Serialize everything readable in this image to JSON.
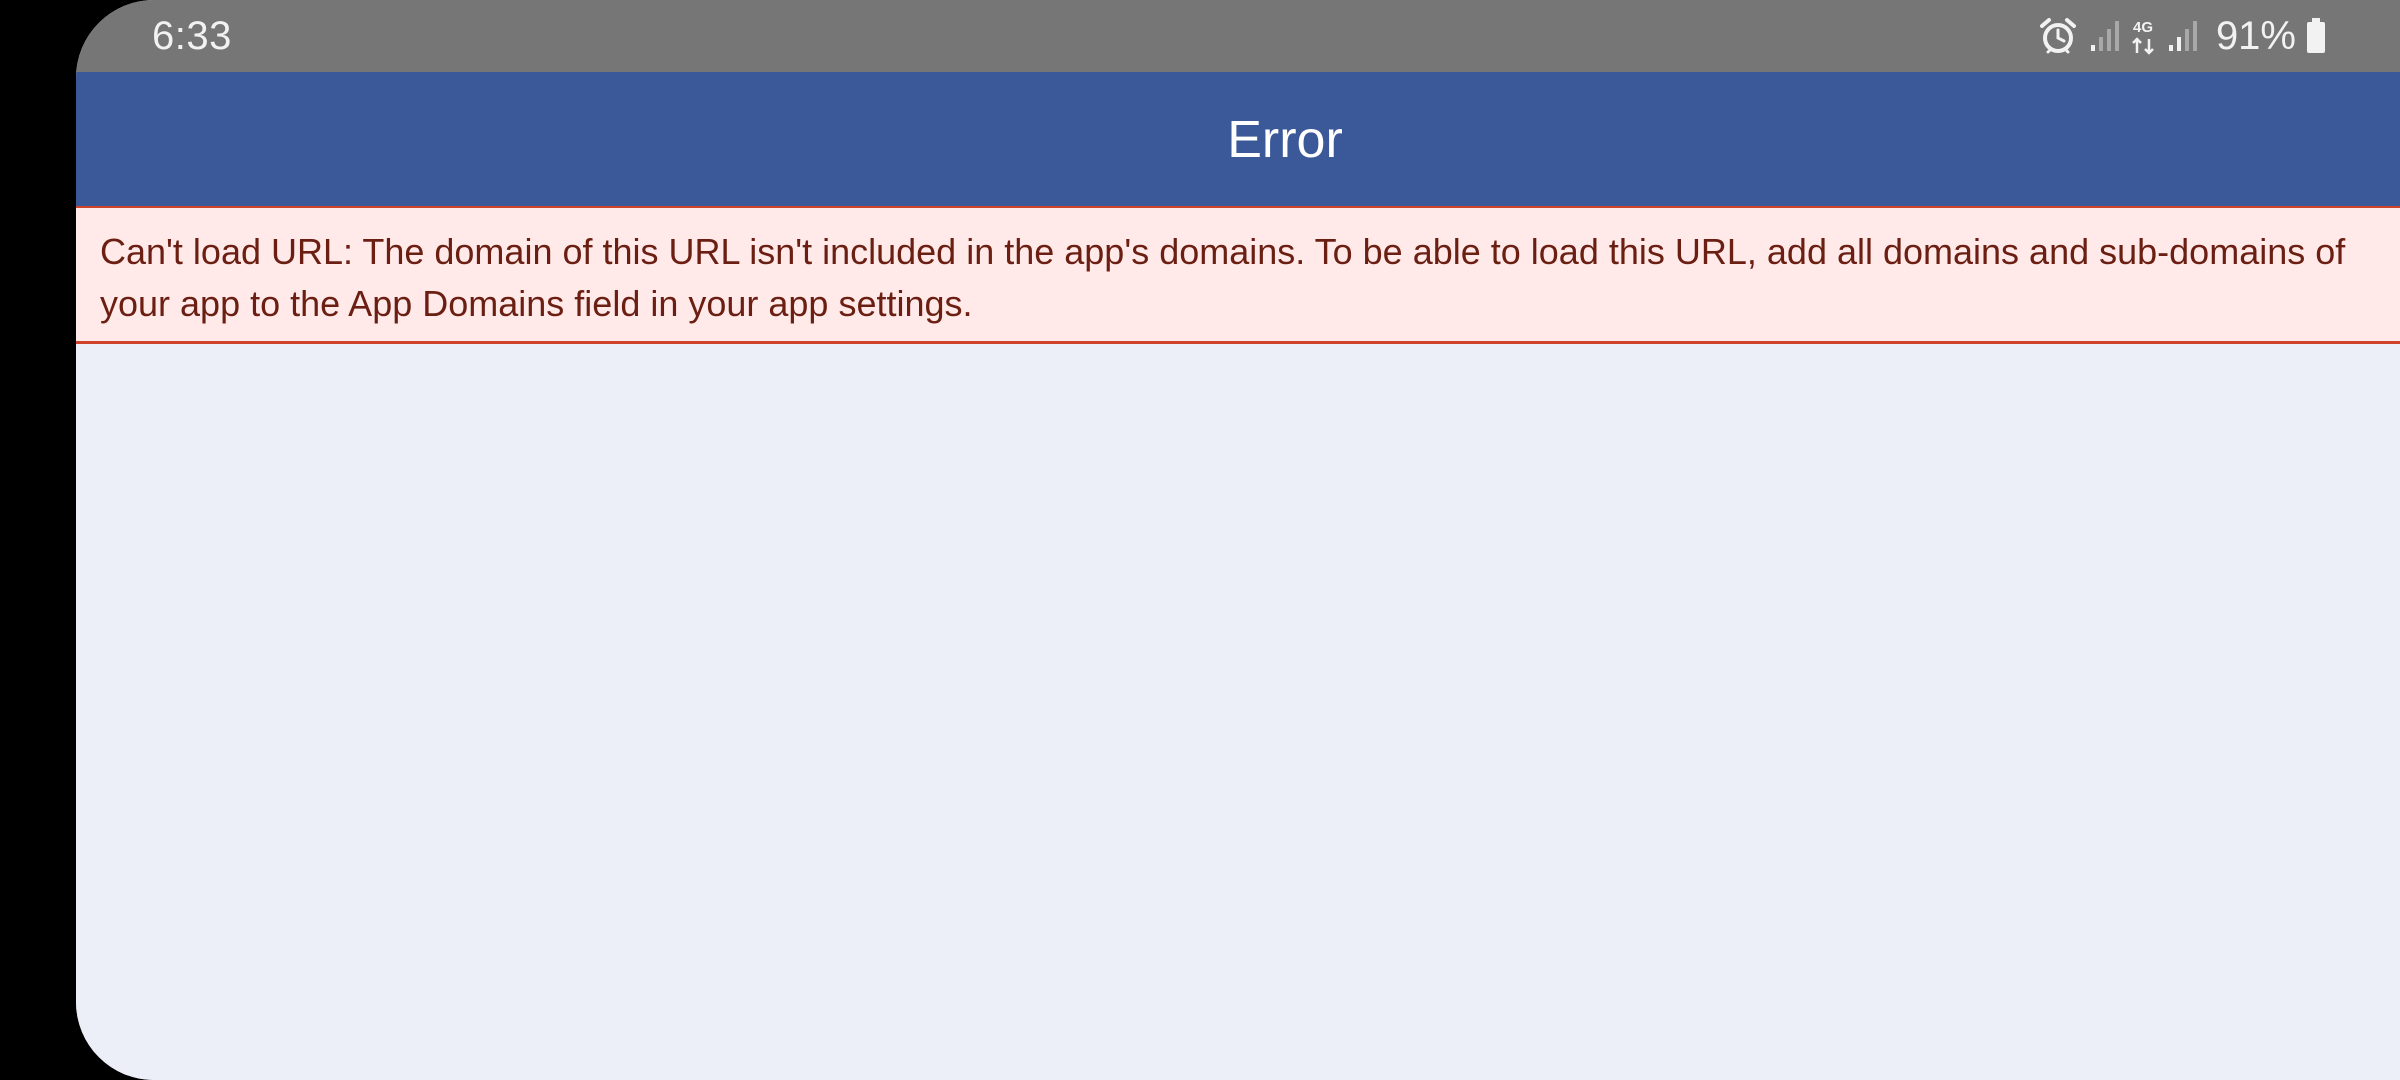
{
  "status_bar": {
    "time": "6:33",
    "network": "4G",
    "battery_percent": "91%",
    "icons": [
      "alarm-icon",
      "signal-icon",
      "4g-data-icon",
      "signal-icon",
      "battery-icon"
    ]
  },
  "app_bar": {
    "title": "Error"
  },
  "error_banner": {
    "message": "Can't load URL: The domain of this URL isn't included in the app's domains. To be able to load this URL, add all domains and sub-domains of your app to the App Domains field in your app settings."
  },
  "colors": {
    "status_bar_bg": "#767676",
    "app_bar_bg": "#3b5998",
    "banner_bg": "#ffe9e9",
    "banner_border": "#d0432b",
    "banner_text": "#6b1f12",
    "page_bg": "#eceff7"
  }
}
